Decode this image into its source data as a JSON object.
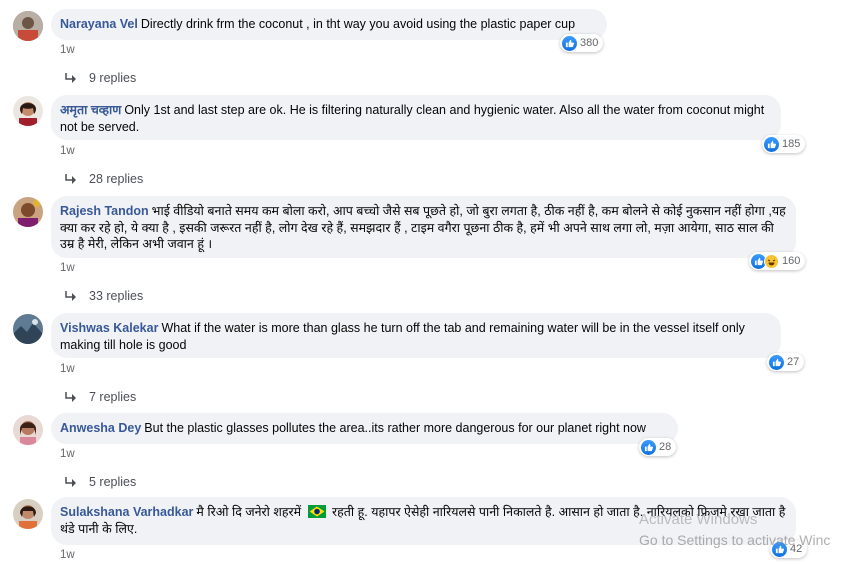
{
  "comments": [
    {
      "author": "Narayana Vel",
      "text": "Directly drink frm the coconut , in tht way you avoid using the plastic paper cup",
      "time": "1w",
      "reactions": "380",
      "replies": "9 replies"
    },
    {
      "author": "अमृता चव्हाण",
      "text": "Only 1st and last step are ok. He is filtering naturally clean and hygienic water. Also all the water from coconut might not be served.",
      "time": "1w",
      "reactions": "185",
      "replies": "28 replies"
    },
    {
      "author": "Rajesh Tandon",
      "text": "भाई वीडियो बनाते समय कम बोला करो, आप बच्चो जैसे सब पूछते हो, जो बुरा लगता है, ठीक नहीं है, कम बोलने से कोई नुकसान नहीं होगा ,यह क्या कर रहे हो, ये क्या है , इसकी जरूरत नहीं है, लोग देख रहे हैं, समझदार हैं , टाइम वगैरा पूछना ठीक है, हमें भी अपने साथ लगा लो, मज़ा आयेगा, साठ साल की उम्र है मेरी, लेकिन अभी जवान हूं ।",
      "time": "1w",
      "reactions": "160",
      "replies": "33 replies"
    },
    {
      "author": "Vishwas Kalekar",
      "text": "What if the water is more than glass he turn off the tab and remaining water will be in the vessel itself only making till hole is good",
      "time": "1w",
      "reactions": "27",
      "replies": "7 replies"
    },
    {
      "author": "Anwesha Dey",
      "text": "But the plastic glasses pollutes the area..its rather more dangerous for our planet right now",
      "time": "1w",
      "reactions": "28",
      "replies": "5 replies"
    },
    {
      "author": "Sulakshana Varhadkar",
      "text_before": "मै रिओ दि जनेरो शहरमें",
      "text_after": "रहती हू. यहापर ऐसेही नारियलसे पानी निकालते है. आसान हो जाता है. नारियलको फ्रिजमे रखा जाता है थंडे पानी के लिए.",
      "time": "1w",
      "reactions": "42"
    }
  ],
  "watermark": {
    "line1": "Activate Windows",
    "line2": "Go to Settings to activate Winc"
  },
  "colors": {
    "name": "#385898",
    "bubble": "#f0f2f5",
    "like": "#1877f2",
    "flag_green": "#009b3a",
    "flag_yellow": "#fedf00",
    "flag_blue": "#002776"
  }
}
